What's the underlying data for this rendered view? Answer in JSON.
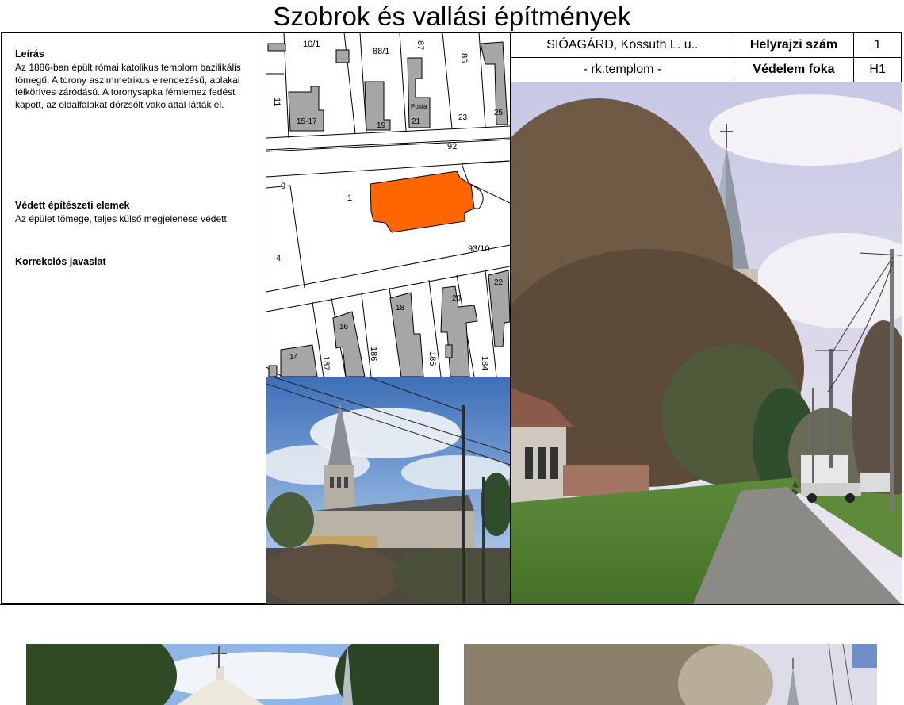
{
  "page": {
    "title": "Szobrok és vallási építmények"
  },
  "description": {
    "heading": "Leírás",
    "text": "Az 1886-ban épült  római katolikus templom bazilikális tömegű. A torony aszimmetrikus elrendezésű, ablakai félköríves záródású. A toronysapka fémlemez fedést kapott, az oldalfalakat dörzsölt vakolattal látták el."
  },
  "protected": {
    "heading": "Védett építészeti elemek",
    "text": "Az épület tömege, teljes külső megjelenése védett."
  },
  "correction": {
    "heading": "Korrekciós javaslat"
  },
  "info": {
    "address": "SIÓAGÁRD, Kossuth L. u..",
    "name": "- rk.templom -",
    "lot_label": "Helyrajzi szám",
    "lot_value": "1",
    "protection_label": "Védelem foka",
    "protection_value": "H1"
  },
  "map": {
    "labels": {
      "l10_1": "10/1",
      "l88_1": "88/1",
      "l87": "87",
      "l86": "86",
      "l11": "11",
      "l15_17": "15-17",
      "l19": "19",
      "posta": "Posta",
      "l21": "21",
      "l23": "23",
      "l25": "25",
      "l92": "92",
      "l9": "9",
      "l1": "1",
      "l4": "4",
      "l93_10": "93/10",
      "l22": "22",
      "l18": "18",
      "l20": "20",
      "l16": "16",
      "l14": "14",
      "l187": "187",
      "l186": "186",
      "l185": "185",
      "l184": "184"
    },
    "church_color": "#ff6600",
    "building_color": "#a6a6a6"
  }
}
